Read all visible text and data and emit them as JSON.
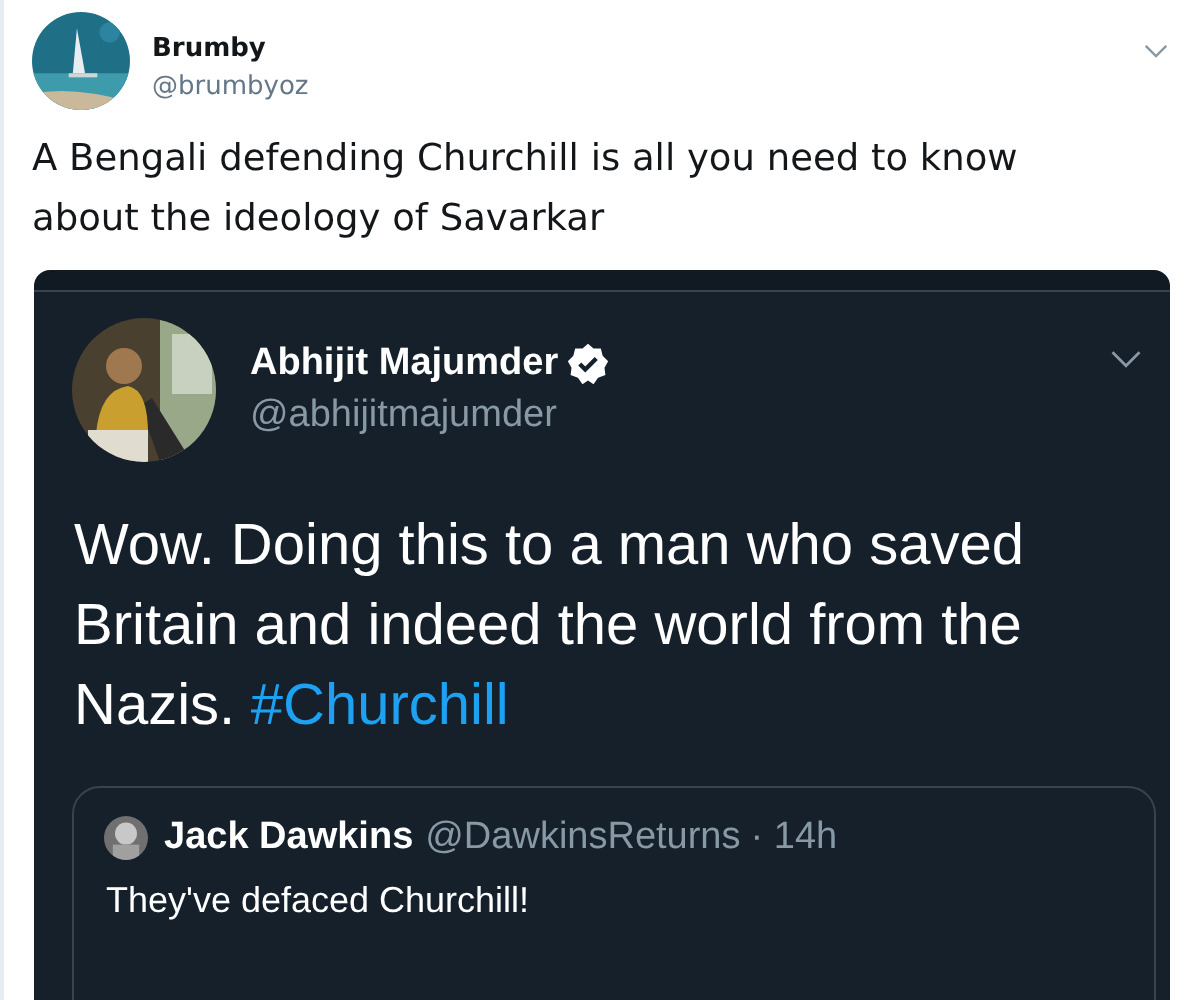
{
  "tweet": {
    "name": "Brumby",
    "handle": "@brumbyoz",
    "text": "A Bengali defending Churchill is all you need to know about the ideology of Savarkar",
    "embedded_screenshot": {
      "name": "Abhijit Majumder",
      "verified": true,
      "handle": "@abhijitmajumder",
      "body": [
        {
          "kind": "plain",
          "text": "Wow. Doing this to a man who saved Britain and indeed the world from the Nazis."
        },
        {
          "kind": "hashtag",
          "text": "#Churchill"
        }
      ],
      "quoted": {
        "name": "Jack Dawkins",
        "handle": "@DawkinsReturns",
        "time": "· 14h",
        "text": "They've defaced Churchill!"
      }
    }
  }
}
